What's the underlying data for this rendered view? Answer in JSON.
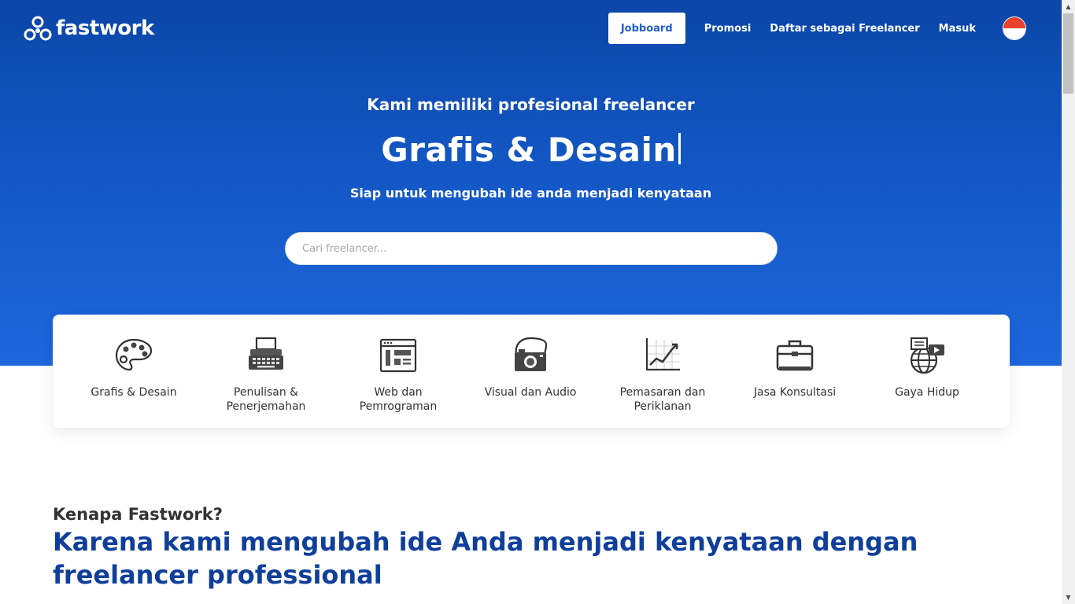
{
  "brand": {
    "name": "fastwork"
  },
  "nav": {
    "jobboard": "Jobboard",
    "promosi": "Promosi",
    "daftar": "Daftar sebagai Freelancer",
    "masuk": "Masuk",
    "language_flag": "indonesia-flag-icon"
  },
  "hero": {
    "subtitle": "Kami memiliki profesional freelancer",
    "title": "Grafis & Desain",
    "description": "Siap untuk mengubah ide anda menjadi kenyataan"
  },
  "search": {
    "placeholder": "Cari freelancer...",
    "value": ""
  },
  "categories": [
    {
      "label": "Grafis & Desain",
      "icon": "palette-icon"
    },
    {
      "label": "Penulisan & Penerjemahan",
      "icon": "typewriter-icon"
    },
    {
      "label": "Web dan Pemrograman",
      "icon": "browser-window-icon"
    },
    {
      "label": "Visual dan Audio",
      "icon": "camera-icon"
    },
    {
      "label": "Pemasaran dan Periklanan",
      "icon": "chart-growth-icon"
    },
    {
      "label": "Jasa Konsultasi",
      "icon": "briefcase-icon"
    },
    {
      "label": "Gaya Hidup",
      "icon": "globe-media-icon"
    }
  ],
  "why": {
    "label": "Kenapa Fastwork?",
    "title": "Karena kami mengubah ide Anda menjadi kenyataan dengan freelancer professional"
  },
  "colors": {
    "hero_top": "#0b46a7",
    "hero_bottom": "#1e66dd",
    "accent_blue": "#1f5fd1",
    "heading_blue": "#0f3f9a"
  }
}
